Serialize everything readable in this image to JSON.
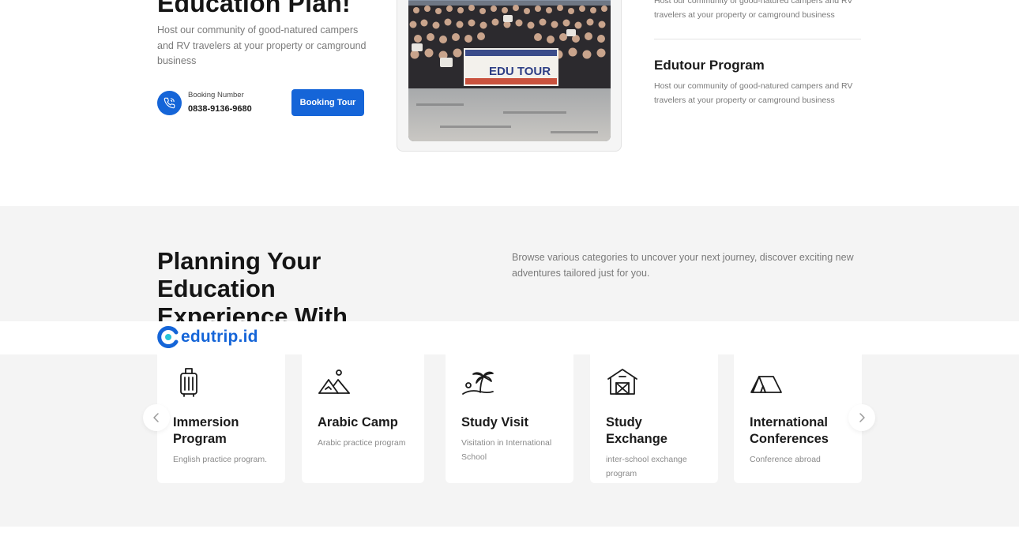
{
  "hero": {
    "title": "Education Plan!",
    "description": "Host our community of good-natured campers and RV travelers at your property or camground business",
    "booking_label": "Booking Number",
    "booking_number": "0838-9136-9680",
    "booking_button": "Booking Tour"
  },
  "photo": {
    "banner_text": "EDU TOUR"
  },
  "programs": [
    {
      "title": "",
      "description": "Host our community of good-natured campers and RV travelers at your property or camground business"
    },
    {
      "title": "Edutour Program",
      "description": "Host our community of good-natured campers and RV travelers at your property or camground business"
    }
  ],
  "categories_section": {
    "title": "Planning Your Education Experience With Edutrip",
    "description": "Browse various categories to uncover your next journey, discover exciting new adventures tailored just for you."
  },
  "logo": {
    "text": "edutrip.id"
  },
  "cards": [
    {
      "title": "Immersion Program",
      "description": "English practice program.",
      "icon": "luggage-icon"
    },
    {
      "title": "Arabic Camp",
      "description": "Arabic practice program",
      "icon": "desert-icon"
    },
    {
      "title": "Study Visit",
      "description": "Visitation in International School",
      "icon": "palm-island-icon"
    },
    {
      "title": "Study Exchange",
      "description": "inter-school exchange program",
      "icon": "barn-icon"
    },
    {
      "title": "International Conferences",
      "description": "Conference abroad",
      "icon": "tent-icon"
    }
  ],
  "colors": {
    "accent": "#1565d8",
    "section_background": "#f4f4f4"
  }
}
